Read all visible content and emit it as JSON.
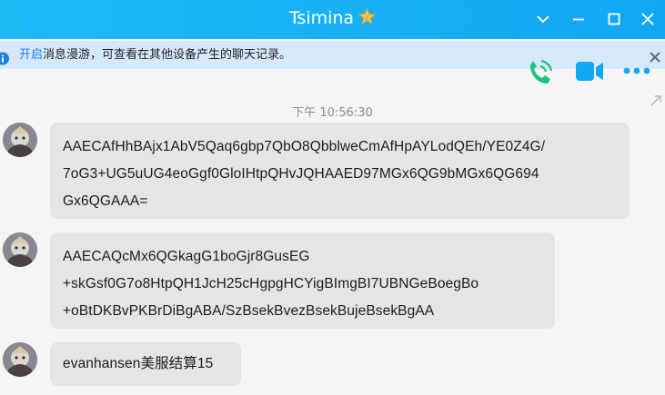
{
  "window": {
    "title": "Tsimina",
    "badge_icon": "vip-star-icon",
    "controls": [
      "chevron-down-icon",
      "minimize-icon",
      "maximize-icon",
      "close-icon"
    ]
  },
  "notice": {
    "link_text": "开启",
    "text": "消息漫游，可查看在其他设备产生的聊天记录。"
  },
  "toolbar": {
    "icons": [
      "voice-call-icon",
      "video-call-icon",
      "more-icon"
    ]
  },
  "chat": {
    "timestamp": "下午 10:56:30",
    "messages": [
      {
        "lines": [
          "AAECAfHhBAjx1AbV5Qaq6gbp7QbO8QbblweCmAfHpAYLodQEh/YE0Z4G/",
          "7oG3+UG5uUG4eoGgf0GloIHtpQHvJQHAAED97MGx6QG9bMGx6QG694",
          "Gx6QGAAA="
        ]
      },
      {
        "lines": [
          "AAECAQcMx6QGkagG1boGjr8GusEG",
          "+skGsf0G7o8HtpQH1JcH25cHgpgHCYigBImgBI7UBNGeBoegBo",
          "+oBtDKBvPKBrDiBgABA/SzBsekBvezBsekBujeBsekBgAA"
        ]
      },
      {
        "lines": [
          "evanhansen美服结算15"
        ]
      }
    ]
  },
  "colors": {
    "titlebar": "#1ebaf8",
    "notice_bg": "#d6e9fb",
    "bubble_bg": "#e5e5e5",
    "link": "#1a7fe0",
    "accent_green": "#1bc47d",
    "accent_blue": "#12a7f3"
  }
}
